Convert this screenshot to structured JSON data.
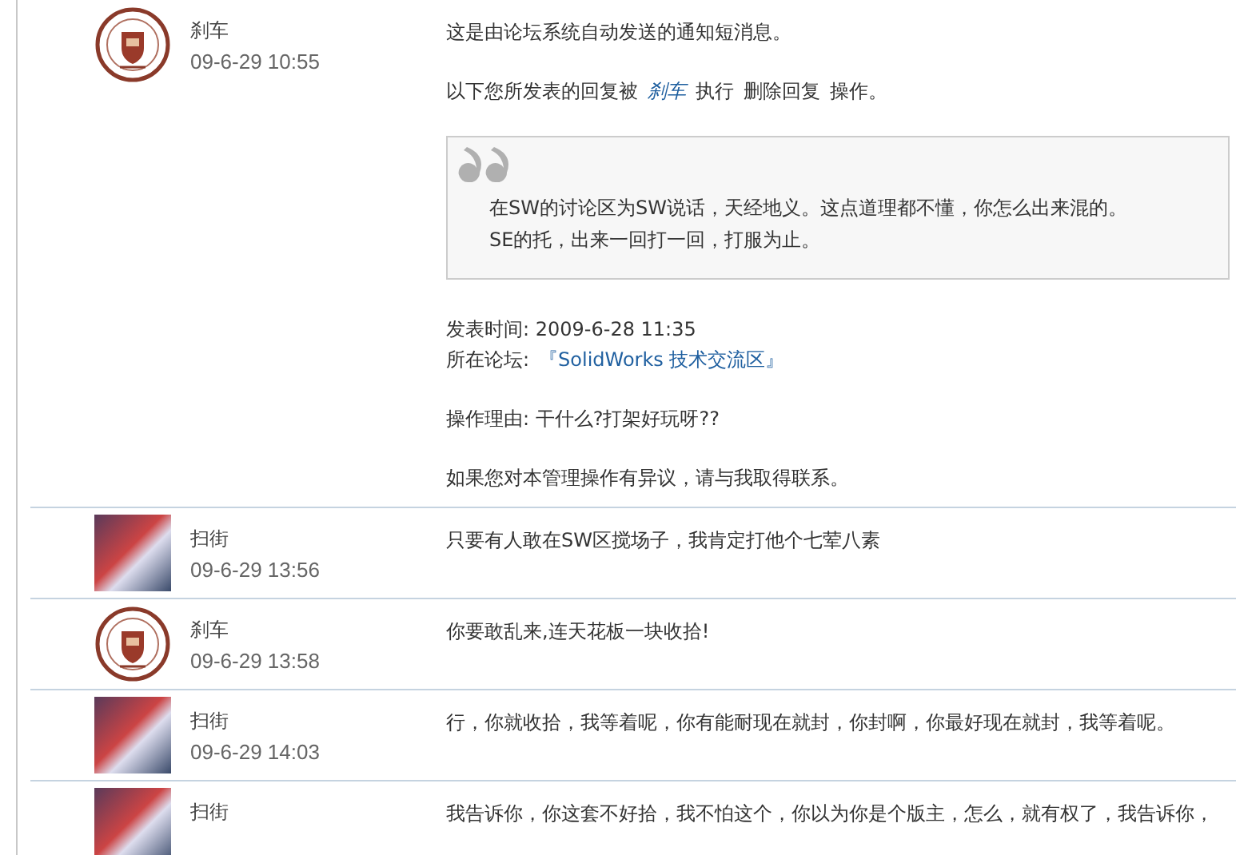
{
  "messages": [
    {
      "author": "刹车",
      "time": "09-6-29 10:55",
      "kind": "seal",
      "blocks": [
        {
          "kind": "para",
          "lines": [
            [
              {
                "kind": "text",
                "text": "这是由论坛系统自动发送的通知短消息。"
              }
            ]
          ]
        },
        {
          "kind": "para",
          "lines": [
            [
              {
                "kind": "text",
                "text": "以下您所发表的回复被"
              },
              {
                "kind": "link",
                "text": "刹车"
              },
              {
                "kind": "text",
                "text": "执行"
              },
              {
                "kind": "text",
                "text": "删除回复"
              },
              {
                "kind": "text",
                "text": "操作。"
              }
            ]
          ]
        },
        {
          "kind": "quote",
          "lines": [
            "在SW的讨论区为SW说话，天经地义。这点道理都不懂，你怎么出来混的。",
            "SE的托，出来一回打一回，打服为止。"
          ]
        },
        {
          "kind": "para",
          "lines": [
            [
              {
                "kind": "text",
                "text": "发表时间: 2009-6-28 11:35"
              }
            ],
            [
              {
                "kind": "text",
                "text": "所在论坛:"
              },
              {
                "kind": "link",
                "text": "『SolidWorks 技术交流区』"
              }
            ]
          ]
        },
        {
          "kind": "para",
          "lines": [
            [
              {
                "kind": "text",
                "text": "操作理由: 干什么?打架好玩呀??"
              }
            ]
          ]
        },
        {
          "kind": "para",
          "lines": [
            [
              {
                "kind": "text",
                "text": "如果您对本管理操作有异议，请与我取得联系。"
              }
            ]
          ]
        }
      ]
    },
    {
      "author": "扫街",
      "time": "09-6-29 13:56",
      "kind": "photo",
      "blocks": [
        {
          "kind": "para",
          "lines": [
            [
              {
                "kind": "text",
                "text": "只要有人敢在SW区搅场子，我肯定打他个七荤八素"
              }
            ]
          ]
        }
      ]
    },
    {
      "author": "刹车",
      "time": "09-6-29 13:58",
      "kind": "seal",
      "blocks": [
        {
          "kind": "para",
          "lines": [
            [
              {
                "kind": "text",
                "text": "你要敢乱来,连天花板一块收拾!"
              }
            ]
          ]
        }
      ]
    },
    {
      "author": "扫街",
      "time": "09-6-29 14:03",
      "kind": "photo",
      "blocks": [
        {
          "kind": "para",
          "lines": [
            [
              {
                "kind": "text",
                "text": "行，你就收拾，我等着呢，你有能耐现在就封，你封啊，你最好现在就封，我等着呢。"
              }
            ]
          ]
        }
      ]
    },
    {
      "author": "扫街",
      "kind": "photo",
      "blocks": [
        {
          "kind": "para",
          "lines": [
            [
              {
                "kind": "text",
                "text": "我告诉你，你这套不好拾，我不怕这个，你以为你是个版主，怎么，就有权了，我告诉你，"
              }
            ]
          ]
        }
      ]
    }
  ]
}
